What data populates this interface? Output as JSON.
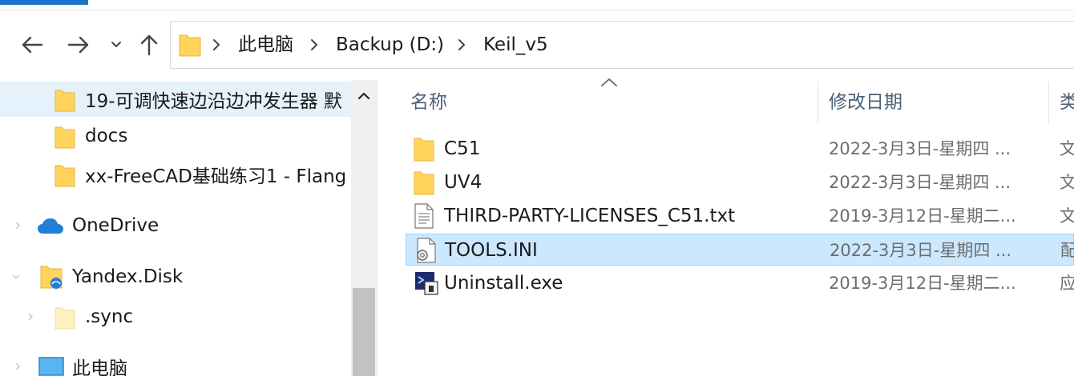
{
  "toolbar": {
    "back_icon": "arrow-left-icon",
    "forward_icon": "arrow-right-icon",
    "recent_icon": "chevron-down-icon",
    "up_icon": "arrow-up-icon"
  },
  "address": {
    "icon": "folder-icon",
    "crumbs": [
      "此电脑",
      "Backup (D:)",
      "Keil_v5"
    ]
  },
  "navigation": {
    "items": [
      {
        "label": "19-可调快速边沿边冲发生器 默",
        "icon": "folder-icon",
        "selected": true
      },
      {
        "label": "docs",
        "icon": "folder-icon"
      },
      {
        "label": "xx-FreeCAD基础练习1 - Flang",
        "icon": "folder-icon"
      },
      {
        "label": "OneDrive",
        "icon": "onedrive-cloud-icon",
        "expandable": true
      },
      {
        "label": "Yandex.Disk",
        "icon": "yandex-disk-folder-icon",
        "expanded": true
      },
      {
        "label": ".sync",
        "icon": "folder-light-icon",
        "expandable": true
      },
      {
        "label": "此电脑",
        "icon": "computer-icon",
        "expandable": true
      }
    ]
  },
  "file_list": {
    "columns": [
      "名称",
      "修改日期",
      "类"
    ],
    "rows": [
      {
        "name": "C51",
        "date": "2022-3月3日-星期四 ...",
        "type": "文",
        "icon": "folder-icon"
      },
      {
        "name": "UV4",
        "date": "2022-3月3日-星期四 ...",
        "type": "文",
        "icon": "folder-icon"
      },
      {
        "name": "THIRD-PARTY-LICENSES_C51.txt",
        "date": "2019-3月12日-星期二...",
        "type": "文",
        "icon": "text-file-icon"
      },
      {
        "name": "TOOLS.INI",
        "date": "2022-3月3日-星期四 ...",
        "type": "配",
        "icon": "config-file-icon",
        "selected": true
      },
      {
        "name": "Uninstall.exe",
        "date": "2019-3月12日-星期二...",
        "type": "应",
        "icon": "uninstall-exe-icon"
      }
    ]
  },
  "colors": {
    "accent": "#1a73c8",
    "folder": "#ffd35c",
    "selection": "#cce8ff",
    "nav_selection": "#e5f1fb",
    "header_text": "#4c607a"
  }
}
